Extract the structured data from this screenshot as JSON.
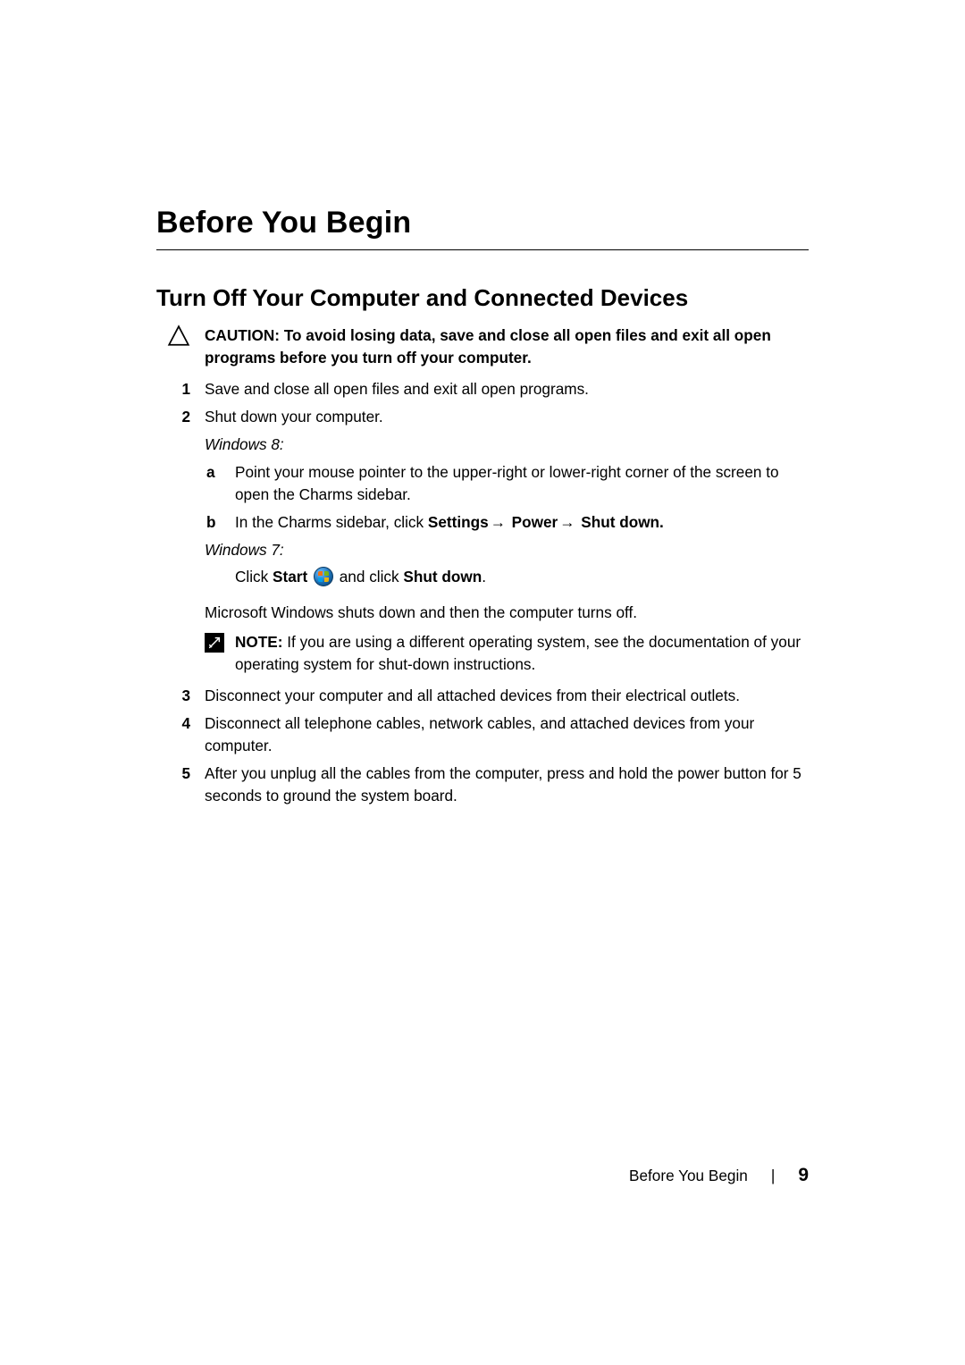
{
  "title": "Before You Begin",
  "section_title": "Turn Off Your Computer and Connected Devices",
  "caution": {
    "label": "CAUTION:",
    "text": "To avoid losing data, save and close all open files and exit all open programs before you turn off your computer."
  },
  "steps": {
    "s1": {
      "num": "1",
      "text": "Save and close all open files and exit all open programs."
    },
    "s2": {
      "num": "2",
      "text": "Shut down your computer.",
      "win8_label": "Windows 8:",
      "sub_a": {
        "letter": "a",
        "text": "Point your mouse pointer to the upper-right or lower-right corner of the screen to open the Charms sidebar."
      },
      "sub_b": {
        "letter": "b",
        "prefix": "In the Charms sidebar, click ",
        "settings": "Settings",
        "power": "Power",
        "shutdown": "Shut down."
      },
      "win7_label": "Windows 7:",
      "win7_line": {
        "click": "Click ",
        "start": "Start",
        "and_click": " and click ",
        "shutdown": "Shut down",
        "period": "."
      },
      "shutdown_result": "Microsoft Windows shuts down and then the computer turns off.",
      "note": {
        "label": "NOTE:",
        "text": "If you are using a different operating system, see the documentation of your operating system for shut-down instructions."
      }
    },
    "s3": {
      "num": "3",
      "text": "Disconnect your computer and all attached devices from their electrical outlets."
    },
    "s4": {
      "num": "4",
      "text": "Disconnect all telephone cables, network cables, and attached devices from your computer."
    },
    "s5": {
      "num": "5",
      "text": "After you unplug all the cables from the computer, press and hold the power button for 5 seconds to ground the system board."
    }
  },
  "arrow": "→",
  "footer": {
    "section": "Before You Begin",
    "page": "9"
  }
}
